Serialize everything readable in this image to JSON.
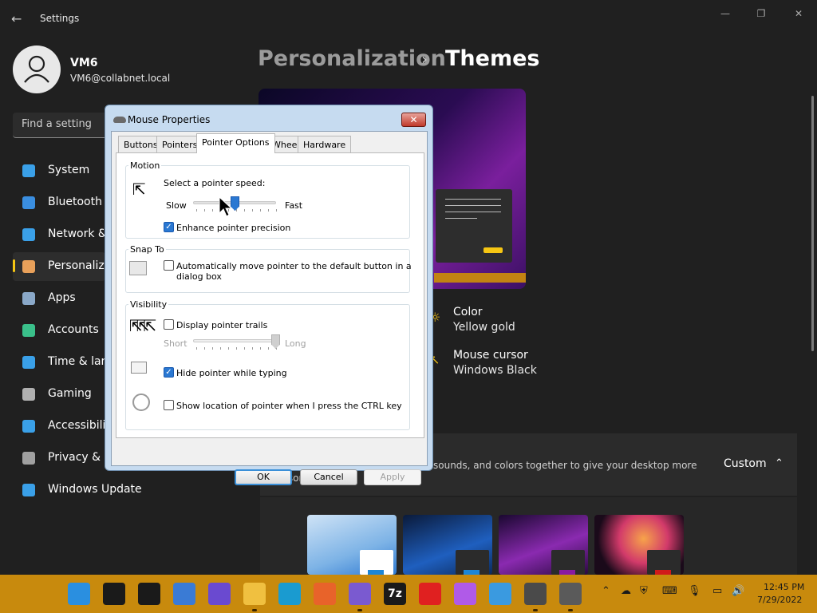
{
  "app": {
    "title": "Settings",
    "back_glyph": "←"
  },
  "window_controls": {
    "minimize": "—",
    "maximize": "❐",
    "close": "✕"
  },
  "user": {
    "name": "VM6",
    "email": "VM6@collabnet.local"
  },
  "search": {
    "placeholder": "Find a setting"
  },
  "nav": [
    {
      "label": "System",
      "icon": "monitor-icon",
      "color": "#3aa0e8"
    },
    {
      "label": "Bluetooth & devices",
      "icon": "bluetooth-icon",
      "color": "#3a8ee0"
    },
    {
      "label": "Network & internet",
      "icon": "wifi-icon",
      "color": "#3aa0e8"
    },
    {
      "label": "Personalization",
      "icon": "brush-icon",
      "color": "#e8a05a"
    },
    {
      "label": "Apps",
      "icon": "apps-icon",
      "color": "#8aa8c8"
    },
    {
      "label": "Accounts",
      "icon": "person-icon",
      "color": "#3ac08a"
    },
    {
      "label": "Time & language",
      "icon": "clock-globe-icon",
      "color": "#3aa0e8"
    },
    {
      "label": "Gaming",
      "icon": "gamepad-icon",
      "color": "#b0b0b0"
    },
    {
      "label": "Accessibility",
      "icon": "accessibility-icon",
      "color": "#3aa0e8"
    },
    {
      "label": "Privacy & security",
      "icon": "shield-icon",
      "color": "#a0a0a0"
    },
    {
      "label": "Windows Update",
      "icon": "update-icon",
      "color": "#3aa0e8"
    }
  ],
  "selected_nav": "Personalization",
  "breadcrumb": {
    "parent": "Personalization",
    "separator": "›",
    "current": "Themes"
  },
  "theme_props": [
    {
      "title": "Color",
      "value": "Yellow gold",
      "icon": "palette-icon"
    },
    {
      "title": "Mouse cursor",
      "value": "Windows Black",
      "icon": "cursor-icon"
    }
  ],
  "theme_band": {
    "description": "A theme is a combination of wallpapers, sounds, and colors together to give your desktop more personality",
    "visible_description": "sounds, and colors together to give your desktop more",
    "visible_description_2": "personality",
    "button": "Custom",
    "chevron": "⌃"
  },
  "dialog": {
    "title": "Mouse Properties",
    "close": "✕",
    "tabs": [
      "Buttons",
      "Pointers",
      "Pointer Options",
      "Wheel",
      "Hardware"
    ],
    "active_tab": "Pointer Options",
    "motion": {
      "group": "Motion",
      "prompt": "Select a pointer speed:",
      "slow": "Slow",
      "fast": "Fast",
      "speed_fraction": 0.5,
      "precision_label": "Enhance pointer precision",
      "precision_checked": true
    },
    "snap": {
      "group": "Snap To",
      "label_line1": "Automatically move pointer to the default button in a",
      "label_line2": "dialog box",
      "checked": false
    },
    "visibility": {
      "group": "Visibility",
      "trails_label": "Display pointer trails",
      "trails_checked": false,
      "short": "Short",
      "long": "Long",
      "trails_fraction": 1.0,
      "hide_label": "Hide pointer while typing",
      "hide_checked": true,
      "ctrl_label": "Show location of pointer when I press the CTRL key",
      "ctrl_checked": false
    },
    "buttons": {
      "ok": "OK",
      "cancel": "Cancel",
      "apply": "Apply"
    }
  },
  "taskbar": {
    "apps": [
      "start-icon",
      "search-icon",
      "task-view-icon",
      "widgets-icon",
      "chat-icon",
      "file-explorer-icon",
      "edge-icon",
      "firefox-icon",
      "store-icon",
      "7zip-icon",
      "yandex-icon",
      "app-icon",
      "finder-icon",
      "settings-icon",
      "mouse-icon"
    ],
    "sevenzip_label": "7z",
    "clock_time": "12:45 PM",
    "clock_date": "7/29/2022"
  },
  "colors": {
    "accent": "#f6c613",
    "taskbar": "#c88a0d",
    "dialog_frame": "#c6dbf0"
  }
}
